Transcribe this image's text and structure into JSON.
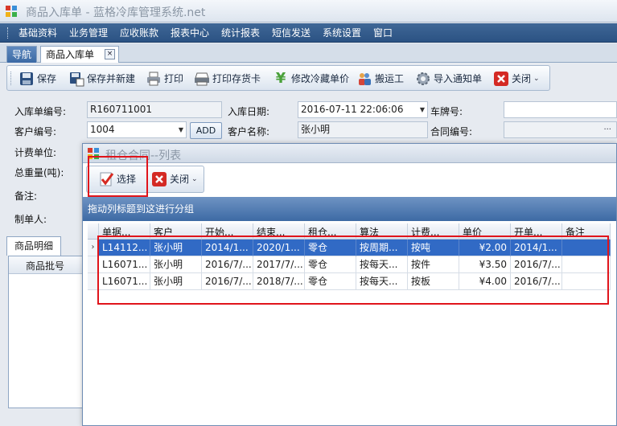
{
  "window": {
    "title": "商品入库单 - 蓝格冷库管理系统.net"
  },
  "menu": [
    "基础资料",
    "业务管理",
    "应收账款",
    "报表中心",
    "统计报表",
    "短信发送",
    "系统设置",
    "窗口"
  ],
  "tabs": {
    "nav": "导航",
    "current": "商品入库单",
    "close_glyph": "×"
  },
  "toolbar": {
    "save": "保存",
    "save_new": "保存并新建",
    "print": "打印",
    "print_card": "打印存货卡",
    "modify_price": "修改冷藏单价",
    "porter": "搬运工",
    "import_notice": "导入通知单",
    "close": "关闭"
  },
  "form": {
    "order_no_label": "入库单编号:",
    "order_no": "R160711001",
    "date_label": "入库日期:",
    "date": "2016-07-11  22:06:06",
    "plate_label": "车牌号:",
    "plate": "",
    "customer_no_label": "客户编号:",
    "customer_no": "1004",
    "add_button": "ADD",
    "customer_name_label": "客户名称:",
    "customer_name": "张小明",
    "contract_no_label": "合同编号:",
    "contract_no": "",
    "ellipsis": "···",
    "billing_unit_label": "计费单位:",
    "total_weight_label": "总重量(吨):",
    "remark_label": "备注:",
    "maker_label": "制单人:"
  },
  "detail": {
    "tab": "商品明细",
    "column_batch": "商品批号"
  },
  "dialog": {
    "title": "租仓合同--列表",
    "select": "选择",
    "close": "关闭",
    "group_hint": "拖动列标题到这进行分组",
    "columns": [
      "单据...",
      "客户",
      "开始...",
      "结束...",
      "租仓...",
      "算法",
      "计费...",
      "单价",
      "开单...",
      "备注"
    ],
    "rows": [
      {
        "selected": true,
        "cells": [
          "L14112...",
          "张小明",
          "2014/1...",
          "2020/1...",
          "零仓",
          "按周期...",
          "按吨",
          "¥2.00",
          "2014/1...",
          ""
        ]
      },
      {
        "selected": false,
        "cells": [
          "L16071...",
          "张小明",
          "2016/7/...",
          "2017/7/...",
          "零仓",
          "按每天...",
          "按件",
          "¥3.50",
          "2016/7/...",
          ""
        ]
      },
      {
        "selected": false,
        "cells": [
          "L16071...",
          "张小明",
          "2016/7/...",
          "2018/7/...",
          "零仓",
          "按每天...",
          "按板",
          "¥4.00",
          "2016/7/...",
          ""
        ]
      }
    ],
    "row_indicator": "›"
  },
  "colors": {
    "menu_bg": "#2f5687",
    "group_bar": "#4a76ae",
    "selection": "#316ac5",
    "highlight_box": "#e0141b"
  }
}
